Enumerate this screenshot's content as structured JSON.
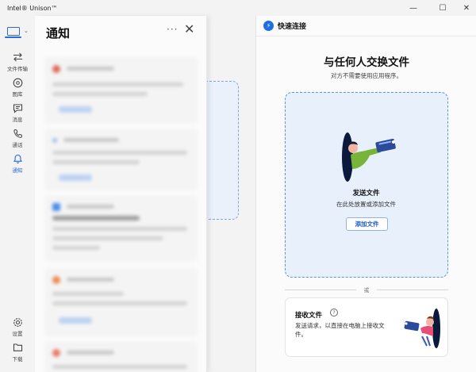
{
  "window": {
    "title": "Intel® Unison™",
    "minimize_glyph": "—",
    "maximize_glyph": "☐",
    "close_glyph": "✕"
  },
  "rail": {
    "device_chevron": "⌄",
    "items": [
      {
        "label": "文件传输",
        "icon": "arrows-transfer-icon"
      },
      {
        "label": "图库",
        "icon": "gallery-icon"
      },
      {
        "label": "消息",
        "icon": "message-icon"
      },
      {
        "label": "通话",
        "icon": "phone-icon"
      },
      {
        "label": "通知",
        "icon": "bell-icon",
        "active": true
      }
    ],
    "bottom_items": [
      {
        "label": "设置",
        "icon": "gear-icon"
      },
      {
        "label": "下载",
        "icon": "folder-icon"
      }
    ]
  },
  "notifications": {
    "title": "通知",
    "more_glyph": "···",
    "close_glyph": "✕"
  },
  "quick_share": {
    "header": "快速连接",
    "heading": "与任何人交换文件",
    "subheading": "对方不需要使用应用程序。",
    "send": {
      "title": "发送文件",
      "description": "在此处放置或添加文件",
      "button": "添加文件"
    },
    "or_label": "或",
    "receive": {
      "title": "接收文件",
      "help_glyph": "?",
      "description": "发送请求，以直接在电脑上接收文件。"
    }
  },
  "colors": {
    "accent": "#1f6fe0",
    "drop_zone_border": "#5b93e5",
    "drop_zone_fill": "#e8f0fb"
  }
}
